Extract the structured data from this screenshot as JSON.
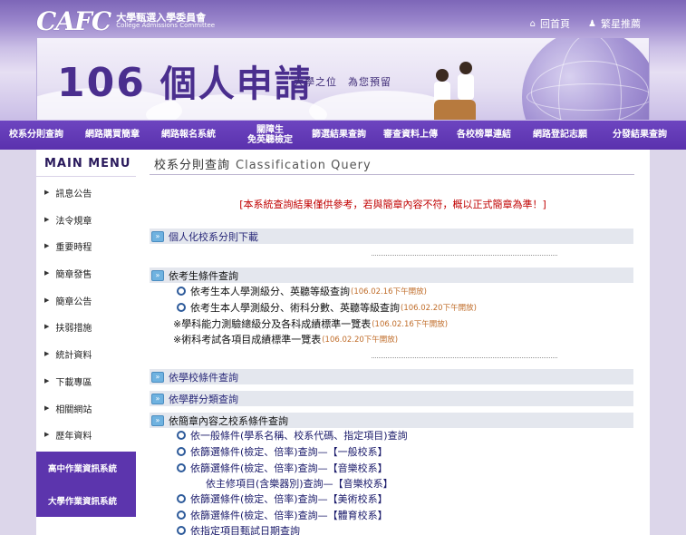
{
  "header": {
    "logo_text": "CAFC",
    "logo_cn": "大學甄選入學委員會",
    "logo_en": "College Admissions Committee",
    "link_home": "回首頁",
    "link_recommend": "繁星推薦",
    "banner_num": "106",
    "banner_title": "個人申請",
    "banner_slogan": "大學之位　為您預留"
  },
  "nav": {
    "items": [
      {
        "label": "校系分則查詢"
      },
      {
        "label": "網路購買簡章"
      },
      {
        "label": "網路報名系統"
      },
      {
        "label": "關障生",
        "label2": "免英聽檢定"
      },
      {
        "label": "篩選結果查詢"
      },
      {
        "label": "審查資料上傳"
      },
      {
        "label": "各校榜單連結"
      },
      {
        "label": "網路登記志願"
      },
      {
        "label": "分發結果查詢"
      }
    ]
  },
  "sidebar": {
    "title": "MAIN MENU",
    "items": [
      {
        "label": "訊息公告"
      },
      {
        "label": "法令規章"
      },
      {
        "label": "重要時程"
      },
      {
        "label": "簡章發售"
      },
      {
        "label": "簡章公告"
      },
      {
        "label": "扶弱措施"
      },
      {
        "label": "統計資料"
      },
      {
        "label": "下載專區"
      },
      {
        "label": "相關網站"
      },
      {
        "label": "歷年資料"
      }
    ],
    "btn_high": "高中作業資訊系統",
    "btn_univ": "大學作業資訊系統"
  },
  "content": {
    "title_cn": "校系分則查詢",
    "title_en": "Classification Query",
    "notice": "[本系統查詢結果僅供參考，若與簡章內容不符，概以正式簡章為準！]",
    "sec1": "個人化校系分則下載",
    "sec2": "依考生條件查詢",
    "sec2_rows": [
      {
        "text": "依考生本人學測級分、英聽等級查詢",
        "date": "(106.02.16下午開放)"
      },
      {
        "text": "依考生本人學測級分、術科分數、英聽等級查詢",
        "date": "(106.02.20下午開放)"
      }
    ],
    "sec2_notes": [
      {
        "text": "※學科能力測驗總級分及各科成績標準一覽表",
        "date": "(106.02.16下午開放)"
      },
      {
        "text": "※術科考試各項目成績標準一覽表",
        "date": "(106.02.20下午開放)"
      }
    ],
    "sec3": "依學校條件查詢",
    "sec4": "依學群分類查詢",
    "sec5": "依簡章內容之校系條件查詢",
    "sec5_rows": [
      "依一般條件(學系名稱、校系代碼、指定項目)查詢",
      "依篩選條件(檢定、倍率)查詢—【一般校系】",
      "依篩選條件(檢定、倍率)查詢—【音樂校系】",
      "依主修項目(含樂器別)查詢—【音樂校系】",
      "依篩選條件(檢定、倍率)查詢—【美術校系】",
      "依篩選條件(檢定、倍率)查詢—【體育校系】",
      "依指定項目甄試日期查詢"
    ]
  },
  "colors": {
    "nav_bg": "#5a31ad",
    "notice": "#c00000",
    "date": "#c06d2a"
  }
}
